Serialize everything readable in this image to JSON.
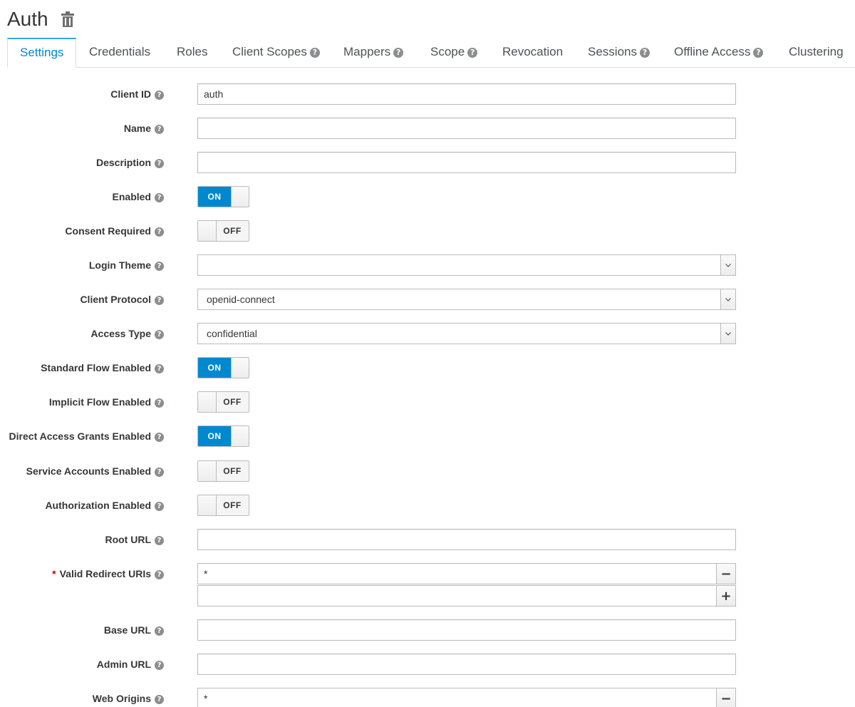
{
  "header": {
    "title": "Auth"
  },
  "tabs": [
    {
      "label": "Settings",
      "help": false,
      "active": true
    },
    {
      "label": "Credentials",
      "help": false
    },
    {
      "label": "Roles",
      "help": false
    },
    {
      "label": "Client Scopes",
      "help": true
    },
    {
      "label": "Mappers",
      "help": true
    },
    {
      "label": "Scope",
      "help": true
    },
    {
      "label": "Revocation",
      "help": false
    },
    {
      "label": "Sessions",
      "help": true
    },
    {
      "label": "Offline Access",
      "help": true
    },
    {
      "label": "Clustering",
      "help": false
    }
  ],
  "help_glyph": "?",
  "switch_labels": {
    "on": "ON",
    "off": "OFF"
  },
  "form": {
    "client_id": {
      "label": "Client ID",
      "value": "auth"
    },
    "name": {
      "label": "Name",
      "value": ""
    },
    "description": {
      "label": "Description",
      "value": ""
    },
    "enabled": {
      "label": "Enabled",
      "state": "on"
    },
    "consent_required": {
      "label": "Consent Required",
      "state": "off"
    },
    "login_theme": {
      "label": "Login Theme",
      "value": ""
    },
    "client_protocol": {
      "label": "Client Protocol",
      "value": "openid-connect"
    },
    "access_type": {
      "label": "Access Type",
      "value": "confidential"
    },
    "standard_flow": {
      "label": "Standard Flow Enabled",
      "state": "on"
    },
    "implicit_flow": {
      "label": "Implicit Flow Enabled",
      "state": "off"
    },
    "direct_access": {
      "label": "Direct Access Grants Enabled",
      "state": "on"
    },
    "service_accounts": {
      "label": "Service Accounts Enabled",
      "state": "off"
    },
    "authorization": {
      "label": "Authorization Enabled",
      "state": "off"
    },
    "root_url": {
      "label": "Root URL",
      "value": ""
    },
    "valid_redirect_uris": {
      "label": "Valid Redirect URIs",
      "required_mark": "*",
      "values": [
        "*",
        ""
      ]
    },
    "base_url": {
      "label": "Base URL",
      "value": ""
    },
    "admin_url": {
      "label": "Admin URL",
      "value": ""
    },
    "web_origins": {
      "label": "Web Origins",
      "values": [
        "*"
      ]
    }
  },
  "buttons": {
    "remove": "−",
    "add": "+"
  }
}
